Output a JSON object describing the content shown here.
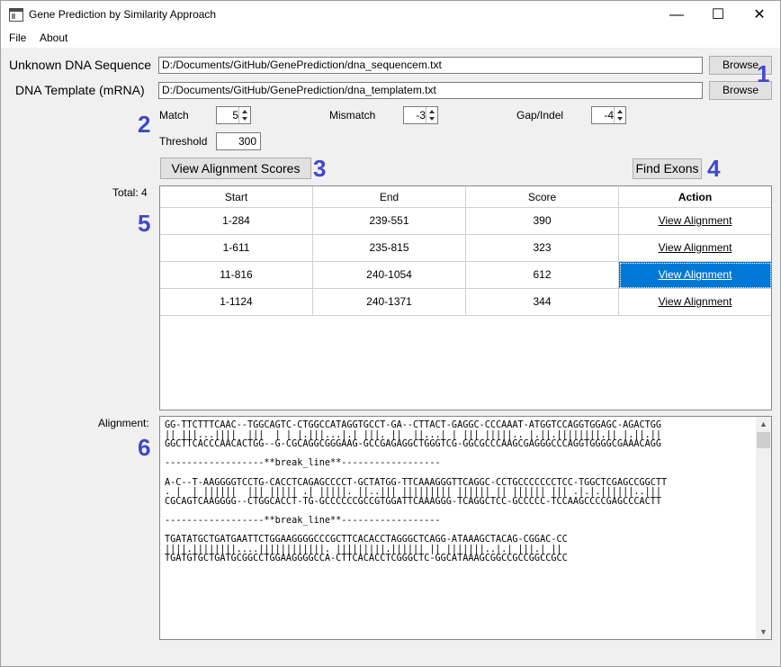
{
  "window": {
    "title": "Gene Prediction by Similarity Approach",
    "minimize": "—",
    "maximize": "☐",
    "close": "✕"
  },
  "menu": {
    "file": "File",
    "about": "About"
  },
  "inputs": {
    "unknown_label": "Unknown DNA Sequence",
    "unknown_path": "D:/Documents/GitHub/GenePrediction/dna_sequencem.txt",
    "template_label": "DNA Template (mRNA)",
    "template_path": "D:/Documents/GitHub/GenePrediction/dna_templatem.txt",
    "browse": "Browse"
  },
  "params": {
    "match_label": "Match",
    "match_value": "5",
    "mismatch_label": "Mismatch",
    "mismatch_value": "-3",
    "gap_label": "Gap/Indel",
    "gap_value": "-4",
    "threshold_label": "Threshold",
    "threshold_value": "300"
  },
  "buttons": {
    "view_scores": "View Alignment Scores",
    "find_exons": "Find Exons"
  },
  "markers": {
    "m1": "1",
    "m2": "2",
    "m3": "3",
    "m4": "4",
    "m5": "5",
    "m6": "6"
  },
  "results": {
    "total": "Total: 4",
    "headers": [
      "Start",
      "End",
      "Score",
      "Action"
    ],
    "rows": [
      {
        "start": "1-284",
        "end": "239-551",
        "score": "390",
        "action": "View Alignment"
      },
      {
        "start": "1-611",
        "end": "235-815",
        "score": "323",
        "action": "View Alignment"
      },
      {
        "start": "11-816",
        "end": "240-1054",
        "score": "612",
        "action": "View Alignment"
      },
      {
        "start": "1-1124",
        "end": "240-1371",
        "score": "344",
        "action": "View Alignment"
      }
    ]
  },
  "alignment": {
    "label": "Alignment:",
    "text": "GG-TTCTTTCAAC--TGGCAGTC-CTGGCCATAGGTGCCT-GA--CTTACT-GAGGC-CCCAAAT-ATGGTCCAGGTGGAGC-AGACTGG\n|| |||...||||  |||  | | |.|||...|.| |||. ||  ||...| | ||| |||||.. |.||.||||||||.|| |.||.||\nGGCTTCACCCAACACTGG--G-CGCAGGCGGGAAG-GCCGAGAGGCTGGGTCG-GGCGCCCAAGCGAGGGCCCAGGTGGGGCGAAACAGG\n\n------------------**break_line**------------------\n\nA-C--T-AAGGGGTCCTG-CACCTCAGAGCCCCT-GCTATGG-TTCAAAGGGTTCAGGC-CCTGCCCCCCCTCC-TGGCTCGAGCCGGCTT\n. |  | ||||||  ||| ||||| .| |||||. ||..||| ||||||||| |||||| || |||||| ||| .|.|.||||||..|||\nCGCAGTCAAGGGG--CTGGCACCT-TG-GCCCCCCGCCGTGGATTCAAAGGG-TCAGGCTCC-GCCCCC-TCCAAGCCCCGAGCCCACTT\n\n------------------**break_line**------------------\n\nTGATATGCTGATGAATTCTGGAAGGGGCCCGCTTCACACCTAGGGCTCAGG-ATAAAGCTACAG-CGGAC-CC\n||||.||||||||....||||||||||||. |||||||||.|||||| || |||||||..|.| |||.| ||\nTGATGTGCTGATGCGGCCTGGAAGGGGCCA-CTTCACACCTCGGGCTC-GGCATAAAGCGGCCGCCGGCCGCC"
  }
}
